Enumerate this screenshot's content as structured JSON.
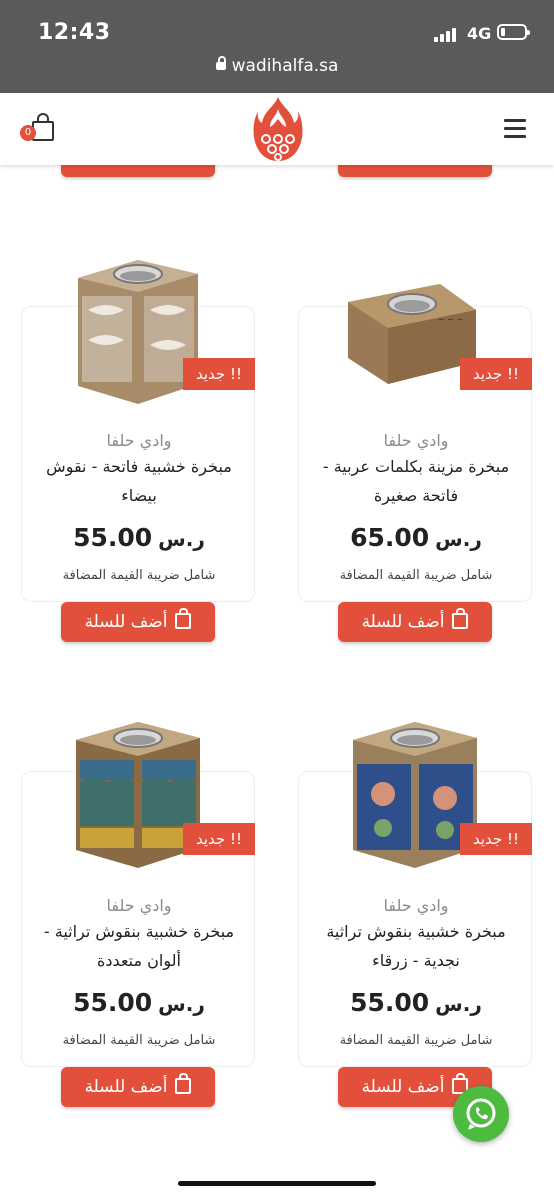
{
  "status_bar": {
    "time": "12:43",
    "network": "4G",
    "url": "wadihalfa.sa"
  },
  "header": {
    "cart_count": "0",
    "brand_color": "#e2503c"
  },
  "products": [
    {
      "brand": "وادي حلفا",
      "name": "مبخرة مزينة بكلمات عربية - فاتحة صغيرة",
      "price": "65.00",
      "currency": "ر.س",
      "tax_note": "شامل ضريبة القيمة المضافة",
      "badge": "جديد !!",
      "add_to_cart": "أضف للسلة",
      "image": "wooden-incense-burner-arabic-words"
    },
    {
      "brand": "وادي حلفا",
      "name": "مبخرة خشبية فاتحة - نقوش بيضاء",
      "price": "55.00",
      "currency": "ر.س",
      "tax_note": "شامل ضريبة القيمة المضافة",
      "badge": "جديد !!",
      "add_to_cart": "أضف للسلة",
      "image": "wooden-incense-burner-white-carving"
    },
    {
      "brand": "وادي حلفا",
      "name": "مبخرة خشبية بنقوش تراثية نجدية - زرقاء",
      "price": "55.00",
      "currency": "ر.س",
      "tax_note": "شامل ضريبة القيمة المضافة",
      "badge": "جديد !!",
      "add_to_cart": "أضف للسلة",
      "image": "wooden-incense-burner-blue-najdi"
    },
    {
      "brand": "وادي حلفا",
      "name": "مبخرة خشبية بنقوش تراثية - ألوان متعددة",
      "price": "55.00",
      "currency": "ر.س",
      "tax_note": "شامل ضريبة القيمة المضافة",
      "badge": "جديد !!",
      "add_to_cart": "أضف للسلة",
      "image": "wooden-incense-burner-multicolor"
    }
  ]
}
